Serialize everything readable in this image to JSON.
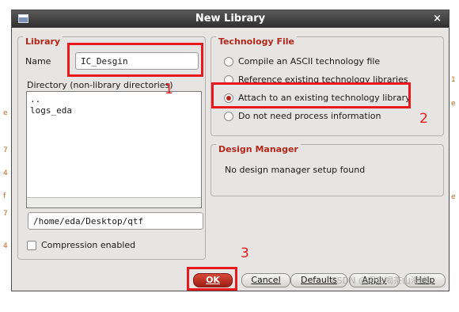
{
  "window": {
    "title": "New Library",
    "close_glyph": "×"
  },
  "library_group": {
    "title": "Library",
    "name_label": "Name",
    "name_value": "IC_Desgin",
    "directory_label": "Directory (non-library directories)",
    "directory_items": [
      "..",
      "logs_eda"
    ],
    "path_value": "/home/eda/Desktop/qtf",
    "compression_label": "Compression enabled",
    "compression_checked": false
  },
  "tech_group": {
    "title": "Technology File",
    "options": [
      {
        "label": "Compile an ASCII technology file",
        "selected": false
      },
      {
        "label": "Reference existing technology libraries",
        "selected": false
      },
      {
        "label": "Attach to an existing technology library",
        "selected": true
      },
      {
        "label": "Do not need process information",
        "selected": false
      }
    ]
  },
  "design_manager": {
    "title": "Design Manager",
    "message": "No design manager setup found"
  },
  "buttons": {
    "ok": "OK",
    "cancel": "Cancel",
    "defaults": "Defaults",
    "apply": "Apply",
    "help": "Help"
  },
  "annotations": {
    "marker_1": "1",
    "marker_2": "2",
    "marker_3": "3",
    "highlight_color": "#e8191c"
  },
  "watermark": "CSDN @观鸟喝茶山海峰"
}
